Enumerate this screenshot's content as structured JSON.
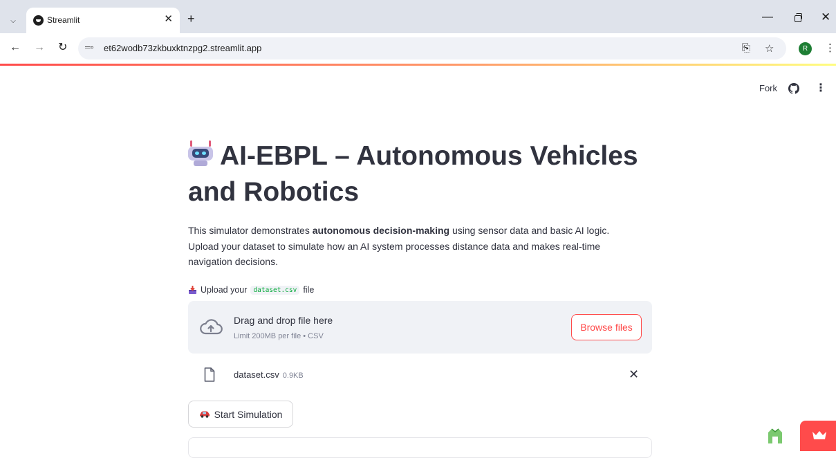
{
  "browser": {
    "tab_title": "Streamlit",
    "new_tab": "+",
    "url": "et62wodb73zkbuxktnzpg2.streamlit.app",
    "profile_initial": "R"
  },
  "header": {
    "fork_label": "Fork"
  },
  "main": {
    "title": "AI-EBPL – Autonomous Vehicles and Robotics",
    "intro_prefix": "This simulator demonstrates ",
    "intro_bold": "autonomous decision-making",
    "intro_suffix": " using sensor data and basic AI logic. Upload your dataset to simulate how an AI system processes distance data and makes real-time navigation decisions.",
    "uploader": {
      "label_prefix": "Upload your",
      "label_code": "dataset.csv",
      "label_suffix": "file",
      "drop_title": "Drag and drop file here",
      "drop_subtitle": "Limit 200MB per file • CSV",
      "browse_label": "Browse files"
    },
    "uploaded_file": {
      "name": "dataset.csv",
      "size": "0.9KB"
    },
    "start_button_label": "Start Simulation"
  },
  "colors": {
    "primary": "#ff4b4b",
    "text": "#31333f",
    "muted": "#808495",
    "dropzone_bg": "#f0f2f6",
    "code_green": "#09ab3b"
  },
  "icons": [
    "chevron-down-icon",
    "streamlit-favicon-icon",
    "close-icon",
    "back-icon",
    "forward-icon",
    "reload-icon",
    "site-info-icon",
    "install-icon",
    "star-icon",
    "more-vert-icon",
    "github-icon",
    "robot-icon",
    "inbox-tray-icon",
    "cloud-upload-icon",
    "file-icon",
    "car-icon",
    "crown-icon"
  ]
}
